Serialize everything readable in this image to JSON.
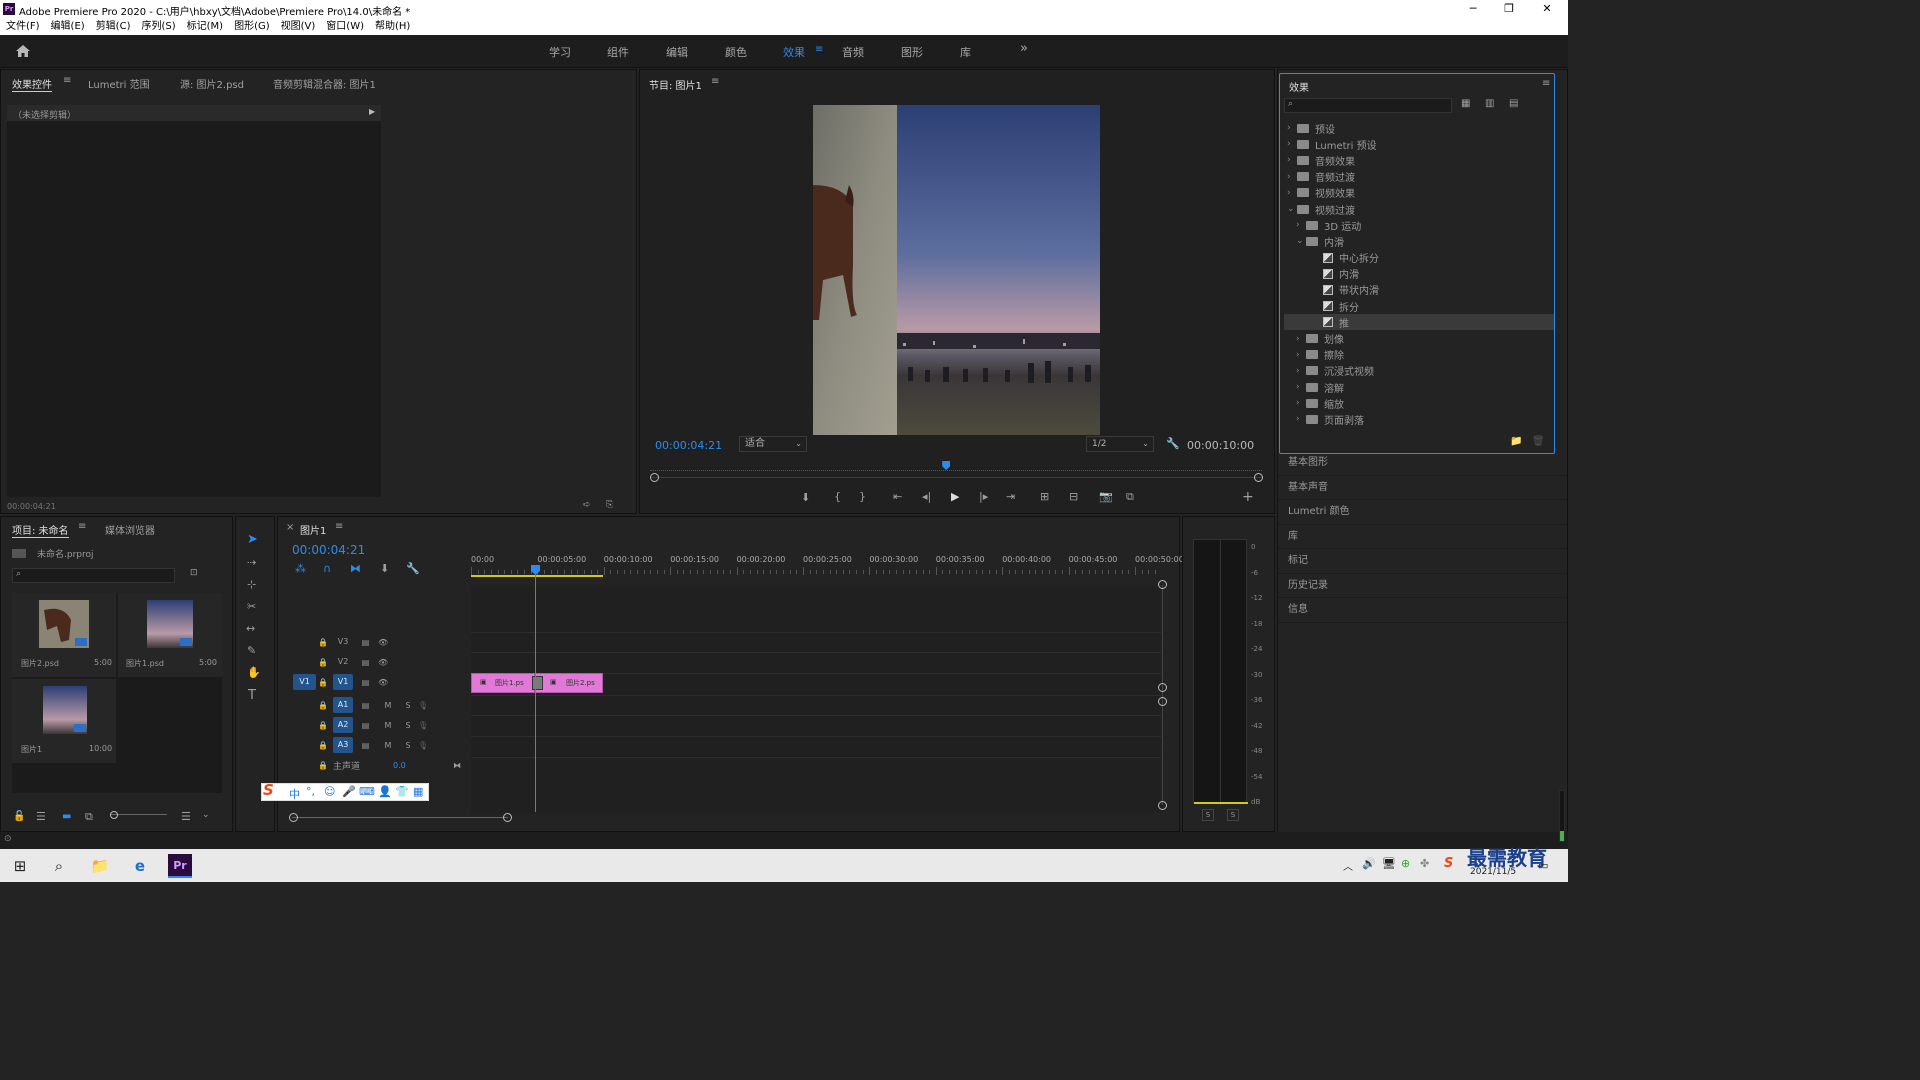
{
  "app": {
    "title": "Adobe Premiere Pro 2020 - C:\\用户\\hbxy\\文档\\Adobe\\Premiere Pro\\14.0\\未命名 *",
    "logo_text": "Pr",
    "win_controls": {
      "minimize": "─",
      "maximize": "❐",
      "close": "✕"
    }
  },
  "menu": [
    "文件(F)",
    "编辑(E)",
    "剪辑(C)",
    "序列(S)",
    "标记(M)",
    "图形(G)",
    "视图(V)",
    "窗口(W)",
    "帮助(H)"
  ],
  "workspaces": {
    "items": [
      "学习",
      "组件",
      "编辑",
      "颜色",
      "效果",
      "音频",
      "图形",
      "库"
    ],
    "active": "效果",
    "more": "»"
  },
  "source_panel": {
    "tabs": [
      "效果控件",
      "Lumetri 范围",
      "源: 图片2.psd",
      "音频剪辑混合器: 图片1"
    ],
    "no_clip": "（未选择剪辑）",
    "timecode": "00:00:04:21"
  },
  "program_monitor": {
    "title": "节目: 图片1",
    "timecode": "00:00:04:21",
    "fit": "适合",
    "resolution": "1/2",
    "duration": "00:00:10:00",
    "playhead_fraction": 0.484
  },
  "effects_panel": {
    "title": "效果",
    "tree": [
      {
        "label": "预设",
        "level": 0,
        "kind": "folder",
        "open": false
      },
      {
        "label": "Lumetri 预设",
        "level": 0,
        "kind": "folder",
        "open": false
      },
      {
        "label": "音频效果",
        "level": 0,
        "kind": "folder",
        "open": false
      },
      {
        "label": "音频过渡",
        "level": 0,
        "kind": "folder",
        "open": false
      },
      {
        "label": "视频效果",
        "level": 0,
        "kind": "folder",
        "open": false
      },
      {
        "label": "视频过渡",
        "level": 0,
        "kind": "folder",
        "open": true
      },
      {
        "label": "3D 运动",
        "level": 1,
        "kind": "folder",
        "open": false
      },
      {
        "label": "内滑",
        "level": 1,
        "kind": "folder",
        "open": true
      },
      {
        "label": "中心拆分",
        "level": 2,
        "kind": "effect"
      },
      {
        "label": "内滑",
        "level": 2,
        "kind": "effect"
      },
      {
        "label": "带状内滑",
        "level": 2,
        "kind": "effect"
      },
      {
        "label": "拆分",
        "level": 2,
        "kind": "effect"
      },
      {
        "label": "推",
        "level": 2,
        "kind": "effect",
        "selected": true
      },
      {
        "label": "划像",
        "level": 1,
        "kind": "folder",
        "open": false
      },
      {
        "label": "擦除",
        "level": 1,
        "kind": "folder",
        "open": false
      },
      {
        "label": "沉浸式视频",
        "level": 1,
        "kind": "folder",
        "open": false
      },
      {
        "label": "溶解",
        "level": 1,
        "kind": "folder",
        "open": false
      },
      {
        "label": "缩放",
        "level": 1,
        "kind": "folder",
        "open": false
      },
      {
        "label": "页面剥落",
        "level": 1,
        "kind": "folder",
        "open": false
      }
    ],
    "side_panels": [
      "基本图形",
      "基本声音",
      "Lumetri 颜色",
      "库",
      "标记",
      "历史记录",
      "信息"
    ]
  },
  "project_panel": {
    "tabs": [
      "项目: 未命名",
      "媒体浏览器"
    ],
    "project_file": "未命名.prproj",
    "items": [
      {
        "name": "图片2.psd",
        "duration": "5:00",
        "thumb": "dog"
      },
      {
        "name": "图片1.psd",
        "duration": "5:00",
        "thumb": "sky"
      },
      {
        "name": "图片1",
        "duration": "10:00",
        "thumb": "sky"
      }
    ]
  },
  "timeline": {
    "title": "图片1",
    "timecode": "00:00:04:21",
    "ruler": [
      "00:00",
      "00:00:05:00",
      "00:00:10:00",
      "00:00:15:00",
      "00:00:20:00",
      "00:00:25:00",
      "00:00:30:00",
      "00:00:35:00",
      "00:00:40:00",
      "00:00:45:00",
      "00:00:50:00"
    ],
    "video_tracks": [
      "V3",
      "V2",
      "V1"
    ],
    "audio_tracks": [
      "A1",
      "A2",
      "A3"
    ],
    "source_patch": "V1",
    "master_label": "主声道",
    "master_value": "0.0",
    "clips": [
      {
        "name": "图片1.ps",
        "track": "V1"
      },
      {
        "name": "图片2.ps",
        "track": "V1"
      }
    ],
    "track_buttons": {
      "mute": "M",
      "solo": "S"
    }
  },
  "audio_meter": {
    "scale": [
      "0",
      "-6",
      "-12",
      "-18",
      "-24",
      "-30",
      "-36",
      "-42",
      "-48",
      "-54",
      "dB"
    ],
    "solo": [
      "S",
      "S"
    ]
  },
  "ime_bar": {
    "logo": "S",
    "mode": "中"
  },
  "taskbar": {
    "date": "2021/11/5",
    "watermark": "最需教育"
  },
  "colors": {
    "accent": "#2d8ceb",
    "clip": "#e07ad6",
    "panel": "#232323",
    "playhead": "#2d8ceb"
  }
}
